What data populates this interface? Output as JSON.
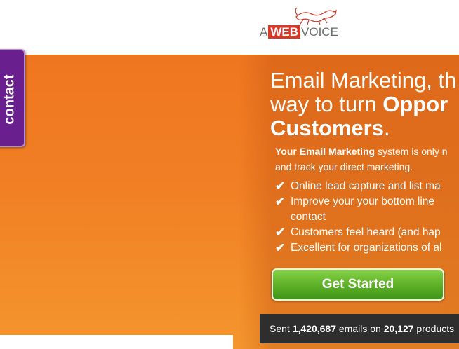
{
  "logo": {
    "prefix": "A",
    "highlight": "WEB",
    "suffix": "VOICE"
  },
  "contact_tab": {
    "label": "contact"
  },
  "hero": {
    "headline_line1": "Email Marketing, th",
    "headline_line2_plain": "way to turn ",
    "headline_line2_bold": "Oppor",
    "headline_line3_bold": "Customers",
    "headline_line3_end": ".",
    "intro_bold": "Your Email Marketing",
    "intro_rest": " system is only n",
    "intro_line2": "and track your direct marketing.",
    "features": [
      "Online lead capture and list ma",
      "Improve your your bottom line contact",
      "Customers feel heard (and hap",
      "Excellent for organizations of al"
    ],
    "check_glyph": "✔",
    "cta_label": "Get Started"
  },
  "stats": {
    "prefix": "Sent ",
    "emails_count": "1,420,687",
    "middle": " emails on ",
    "products_count": "20,127",
    "suffix": " products"
  }
}
